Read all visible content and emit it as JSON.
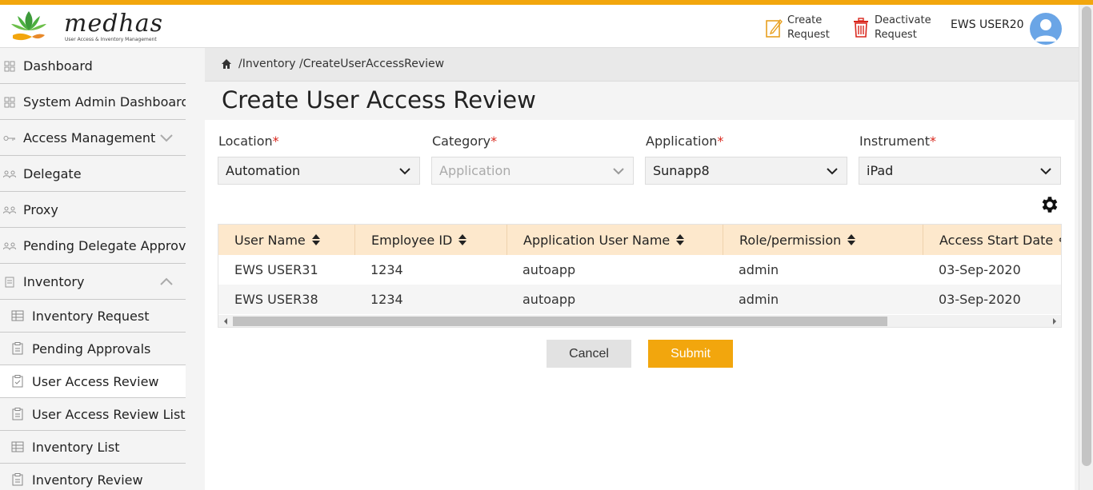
{
  "app": {
    "logo_text": "medhas",
    "logo_sub": "User Access & Inventory Management",
    "accent": "#f2a60d"
  },
  "header": {
    "create_request": [
      "Create",
      "Request"
    ],
    "deactivate_request": [
      "Deactivate",
      "Request"
    ],
    "user_name": "EWS USER20"
  },
  "sidebar": {
    "items": [
      {
        "label": "Dashboard",
        "icon": "grid-icon"
      },
      {
        "label": "System Admin Dashboard",
        "icon": "grid-icon"
      },
      {
        "label": "Access Management",
        "icon": "key-icon",
        "expandable": "collapsed"
      },
      {
        "label": "Delegate",
        "icon": "people-icon"
      },
      {
        "label": "Proxy",
        "icon": "people-icon"
      },
      {
        "label": "Pending Delegate Approval",
        "icon": "people-icon"
      },
      {
        "label": "Inventory",
        "icon": "document-icon",
        "expandable": "expanded"
      }
    ],
    "sub_items": [
      {
        "label": "Inventory Request",
        "icon": "table-icon"
      },
      {
        "label": "Pending Approvals",
        "icon": "clipboard-icon"
      },
      {
        "label": "User Access Review",
        "icon": "clipboard-check-icon",
        "active": true
      },
      {
        "label": "User Access Review List",
        "icon": "clipboard-icon"
      },
      {
        "label": "Inventory List",
        "icon": "table-icon"
      },
      {
        "label": "Inventory Review",
        "icon": "clipboard-icon"
      }
    ]
  },
  "breadcrumb": "/Inventory /CreateUserAccessReview",
  "page": {
    "title": "Create User Access Review"
  },
  "filters": [
    {
      "label": "Location",
      "value": "Automation",
      "disabled": false
    },
    {
      "label": "Category",
      "value": "Application",
      "disabled": true
    },
    {
      "label": "Application",
      "value": "Sunapp8",
      "disabled": false
    },
    {
      "label": "Instrument",
      "value": "iPad",
      "disabled": false
    }
  ],
  "table": {
    "columns": [
      "User Name",
      "Employee ID",
      "Application User Name",
      "Role/permission",
      "Access Start Date"
    ],
    "rows": [
      [
        "EWS USER31",
        "1234",
        "autoapp",
        "admin",
        "03-Sep-2020"
      ],
      [
        "EWS USER38",
        "1234",
        "autoapp",
        "admin",
        "03-Sep-2020"
      ]
    ]
  },
  "actions": {
    "cancel": "Cancel",
    "submit": "Submit"
  }
}
